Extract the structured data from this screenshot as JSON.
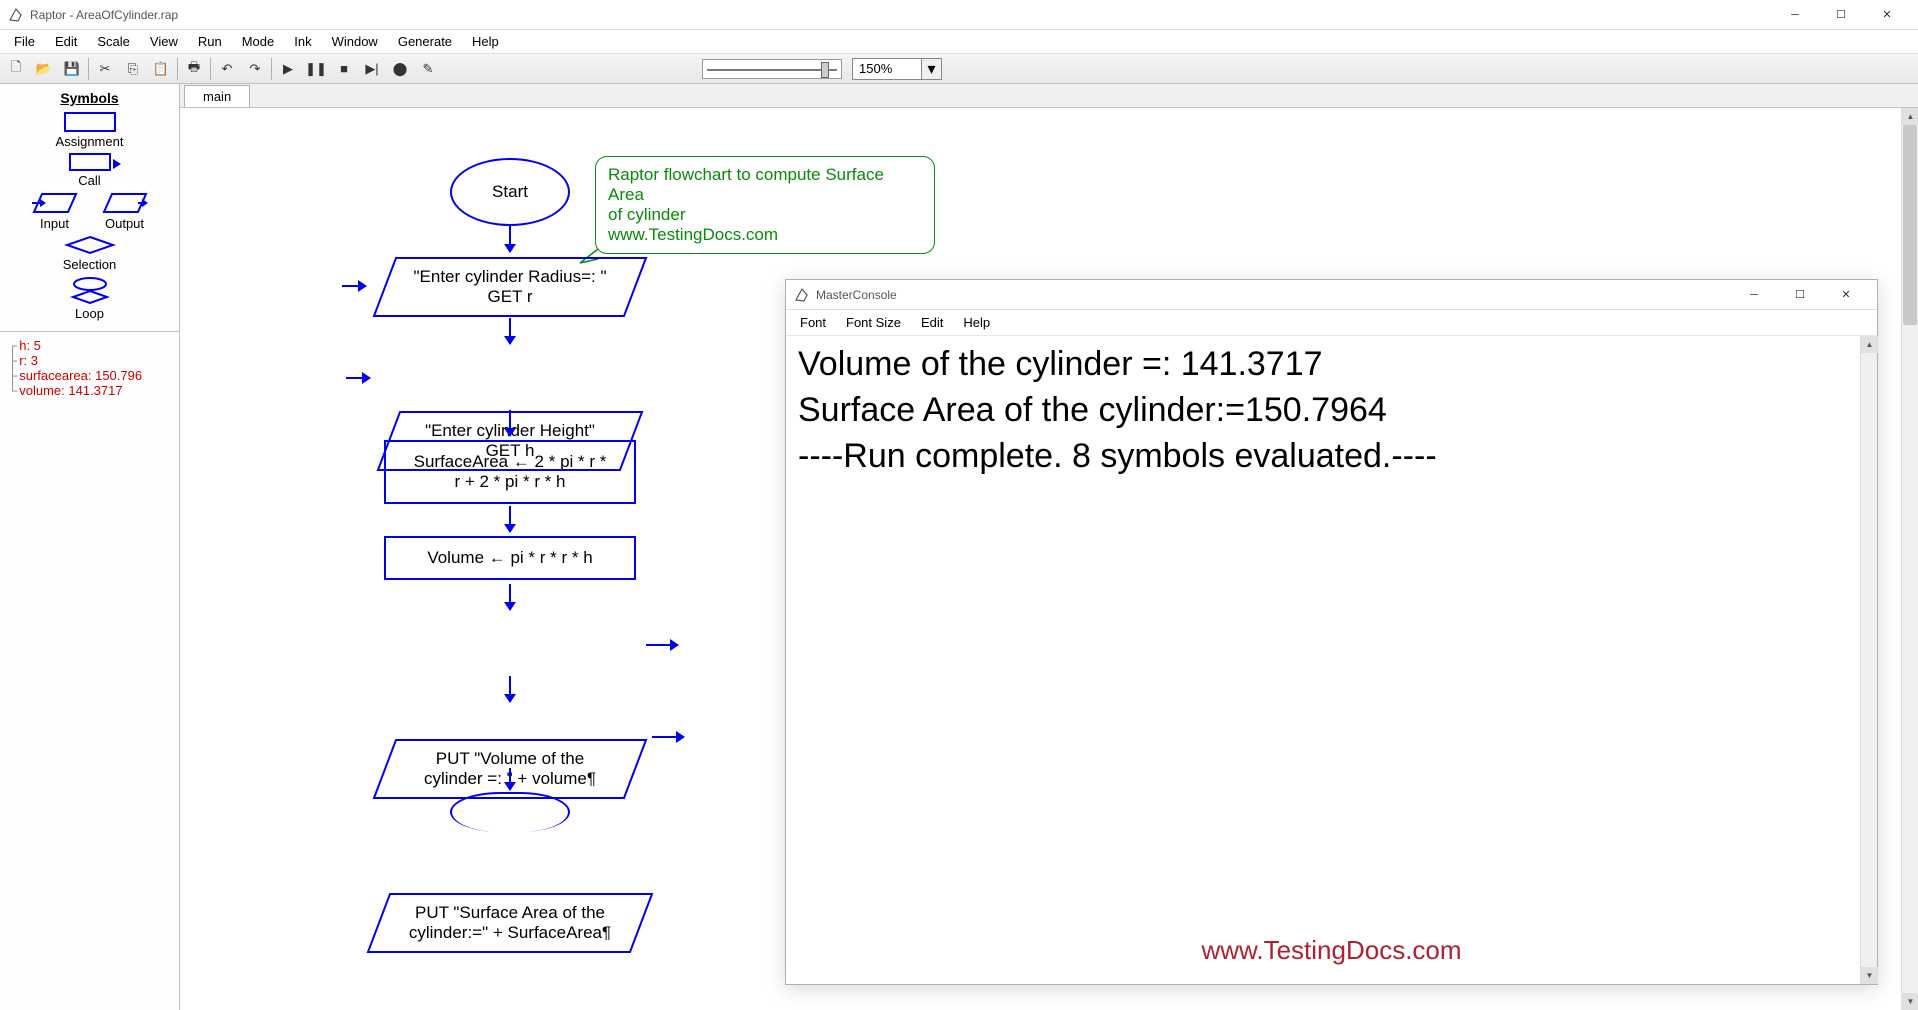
{
  "window": {
    "title": "Raptor - AreaOfCylinder.rap"
  },
  "menu": [
    "File",
    "Edit",
    "Scale",
    "View",
    "Run",
    "Mode",
    "Ink",
    "Window",
    "Generate",
    "Help"
  ],
  "toolbar": {
    "zoom": "150%"
  },
  "sidebar": {
    "header": "Symbols",
    "symbols": {
      "assignment": "Assignment",
      "call": "Call",
      "input": "Input",
      "output": "Output",
      "selection": "Selection",
      "loop": "Loop"
    },
    "variables": [
      "h: 5",
      "r: 3",
      "surfacearea: 150.796",
      "volume: 141.3717"
    ]
  },
  "tabs": [
    {
      "label": "main"
    }
  ],
  "flowchart": {
    "start": "Start",
    "comment": "Raptor flowchart to compute Surface Area\nof cylinder\nwww.TestingDocs.com",
    "node1": "\"Enter cylinder Radius=: \"\nGET r",
    "node2": "\"Enter cylinder Height\"\nGET h",
    "node3": "SurfaceArea ← 2 * pi * r *\nr + 2 * pi * r * h",
    "node4": "Volume ← pi * r * r * h",
    "node5": "PUT \"Volume of the\ncylinder =: \" + volume¶",
    "node6": "PUT \"Surface Area of the\ncylinder:=\" + SurfaceArea¶"
  },
  "console": {
    "title": "MasterConsole",
    "menu": [
      "Font",
      "Font Size",
      "Edit",
      "Help"
    ],
    "lines": [
      "Volume of the cylinder =: 141.3717",
      "Surface Area of the cylinder:=150.7964",
      "----Run complete.  8 symbols evaluated.----"
    ],
    "watermark": "www.TestingDocs.com"
  }
}
